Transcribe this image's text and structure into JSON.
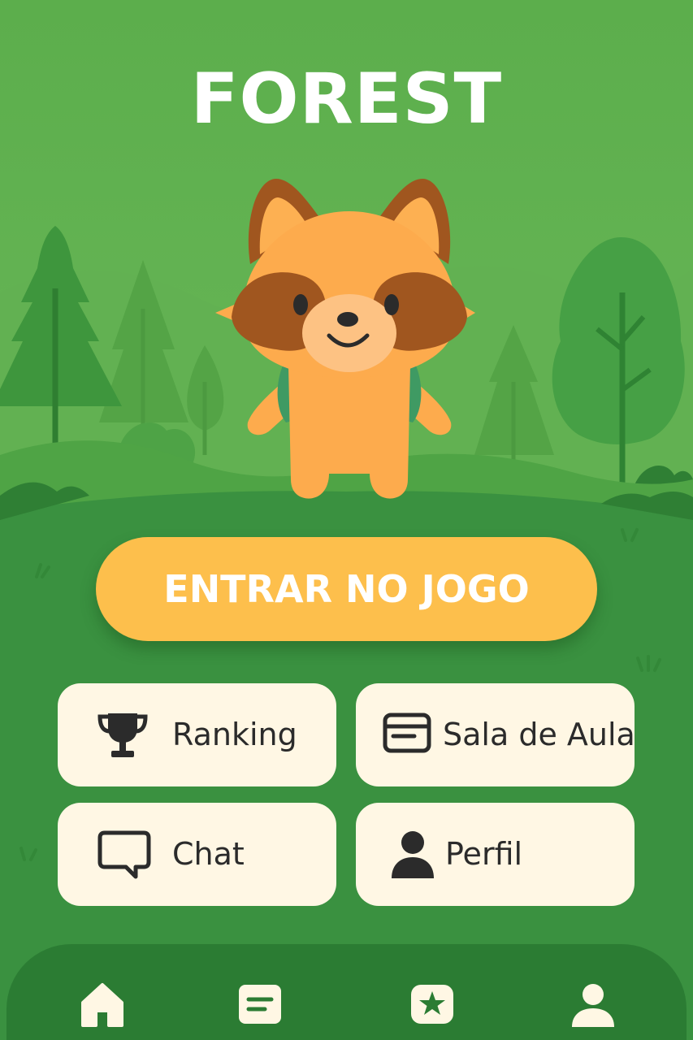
{
  "app": {
    "title": "FOREST"
  },
  "colors": {
    "sky": "#5aad4c",
    "ground": "#3a9140",
    "accent_button": "#fdbf4c",
    "tile_bg": "#fff7e4",
    "nav_bg": "#2b7c33",
    "mascot_fur": "#fdab4d",
    "mascot_mask": "#a05420"
  },
  "mascot": {
    "icon": "red-panda-mascot"
  },
  "main": {
    "enter_button": {
      "label": "ENTRAR NO JOGO"
    },
    "tiles": [
      {
        "label": "Ranking",
        "icon": "trophy-icon"
      },
      {
        "label": "Sala de Aula",
        "icon": "classroom-icon"
      },
      {
        "label": "Chat",
        "icon": "chat-icon"
      },
      {
        "label": "Perfil",
        "icon": "user-icon"
      }
    ]
  },
  "bottom_nav": {
    "items": [
      {
        "icon": "home-icon"
      },
      {
        "icon": "list-icon"
      },
      {
        "icon": "star-icon"
      },
      {
        "icon": "user-icon"
      }
    ]
  }
}
